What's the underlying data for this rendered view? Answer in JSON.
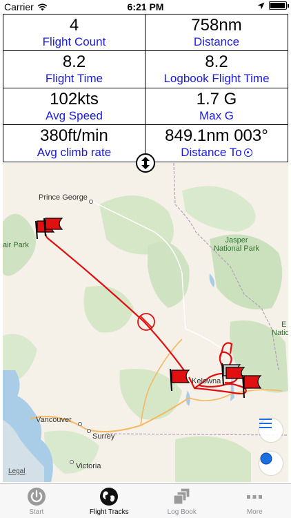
{
  "status_bar": {
    "carrier": "Carrier",
    "time": "6:21 PM",
    "battery_level": 0.95
  },
  "stats": [
    {
      "value": "4",
      "label": "Flight Count"
    },
    {
      "value": "758nm",
      "label": "Distance"
    },
    {
      "value": "8.2",
      "label": "Flight Time"
    },
    {
      "value": "8.2",
      "label": "Logbook Flight Time"
    },
    {
      "value": "102kts",
      "label": "Avg Speed"
    },
    {
      "value": "1.7 G",
      "label": "Max G"
    },
    {
      "value": "380ft/min",
      "label": "Avg climb rate"
    },
    {
      "value": "849.1nm 003°",
      "label": "Distance To"
    }
  ],
  "map": {
    "places": {
      "prince_george": "Prince George",
      "air_park": "air Park",
      "jasper_1": "Jasper",
      "jasper_2": "National Park",
      "edge_e": "E",
      "edge_natio": "Natio",
      "kelowna": "Kelowna",
      "vancouver": "Vancouver",
      "surrey": "Surrey",
      "victoria": "Victoria"
    },
    "legal": "Legal",
    "track_color": "#e01010"
  },
  "tabs": [
    {
      "label": "Start",
      "icon": "power-icon",
      "active": false
    },
    {
      "label": "Flight Tracks",
      "icon": "globe-icon",
      "active": true
    },
    {
      "label": "Log Book",
      "icon": "stack-icon",
      "active": false
    },
    {
      "label": "More",
      "icon": "more-icon",
      "active": false
    }
  ]
}
